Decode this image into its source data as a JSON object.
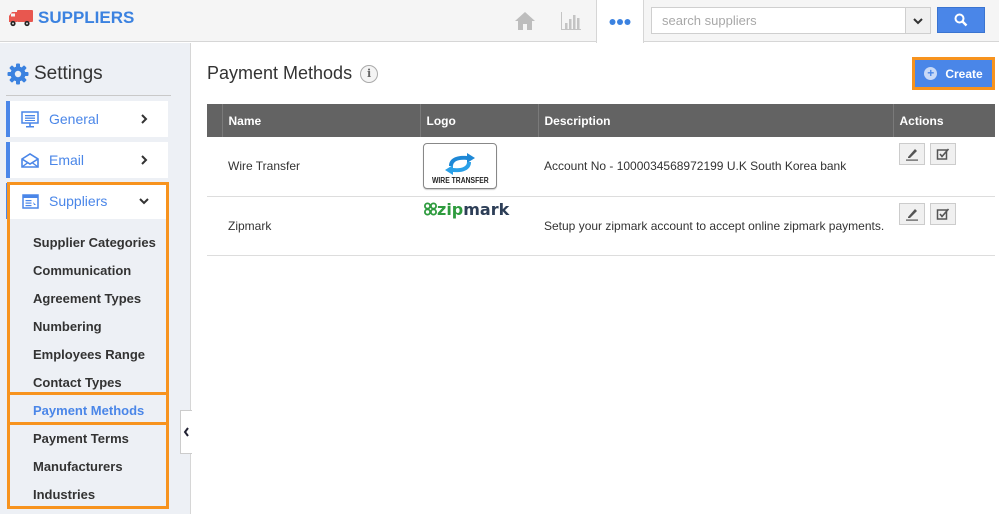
{
  "app": {
    "title": "SUPPLIERS",
    "brand_color": "#3b82e0",
    "icons": {
      "logo": "truck-icon"
    }
  },
  "topnav": {
    "home_icon": "home-icon",
    "reports_icon": "bar-chart-icon",
    "more_icon": "more-dots-icon",
    "search": {
      "placeholder": "search suppliers",
      "value": "",
      "dropdown_icon": "chevron-down-icon",
      "button_icon": "search-icon"
    }
  },
  "sidebar": {
    "title": "Settings",
    "title_icon": "gear-icon",
    "items": [
      {
        "label": "General",
        "icon": "monitor-icon",
        "chevron": "chevron-right-icon",
        "expanded": false
      },
      {
        "label": "Email",
        "icon": "envelope-icon",
        "chevron": "chevron-right-icon",
        "expanded": false
      },
      {
        "label": "Suppliers",
        "icon": "window-icon",
        "chevron": "chevron-down-icon",
        "expanded": true
      }
    ],
    "sub_items": [
      {
        "label": "Supplier Categories",
        "active": false
      },
      {
        "label": "Communication",
        "active": false
      },
      {
        "label": "Agreement Types",
        "active": false
      },
      {
        "label": "Numbering",
        "active": false
      },
      {
        "label": "Employees Range",
        "active": false
      },
      {
        "label": "Contact Types",
        "active": false
      },
      {
        "label": "Payment Methods",
        "active": true
      },
      {
        "label": "Payment Terms",
        "active": false
      },
      {
        "label": "Manufacturers",
        "active": false
      },
      {
        "label": "Industries",
        "active": false
      }
    ],
    "collapse_icon": "chevron-left-icon"
  },
  "main": {
    "title": "Payment Methods",
    "info_icon": "info-icon",
    "create_label": "Create",
    "accent_color": "#4a86e8",
    "highlight_color": "#f7931e",
    "table": {
      "columns": [
        "",
        "Name",
        "Logo",
        "Description",
        "Actions"
      ],
      "rows": [
        {
          "name": "Wire Transfer",
          "logo_text": "WIRE TRANSFER",
          "description": "Account No - 1000034568972199 U.K South Korea bank",
          "actions": [
            "edit-icon",
            "checkbox-edit-icon"
          ]
        },
        {
          "name": "Zipmark",
          "logo_text_a": "zip",
          "logo_text_b": "mark",
          "description": "Setup your zipmark account to accept online zipmark payments.",
          "actions": [
            "edit-icon",
            "checkbox-edit-icon"
          ]
        }
      ]
    }
  }
}
